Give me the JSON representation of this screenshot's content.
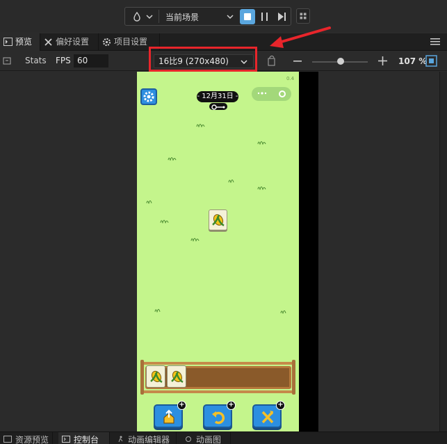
{
  "toolbar": {
    "scene_label": "当前场景",
    "icons": [
      "drop-icon",
      "chevron-down-icon",
      "stop-icon",
      "pause-icon",
      "step-icon",
      "grid-icon"
    ]
  },
  "panel_tabs": [
    {
      "label": "预览",
      "icon": "preview-icon",
      "active": true
    },
    {
      "label": "偏好设置",
      "icon": "tools-icon",
      "active": false
    },
    {
      "label": "项目设置",
      "icon": "gear-icon",
      "active": false
    }
  ],
  "preview_toolbar": {
    "stats_label": "Stats",
    "fps_label": "FPS",
    "fps_value": "60",
    "resolution": "16比9 (270x480)",
    "zoom_value": "107 %"
  },
  "game": {
    "date_label": "- 12月31日 -",
    "tray_tiles": 2,
    "tool_buttons": [
      {
        "name": "move-out-tool",
        "badge": "+"
      },
      {
        "name": "undo-tool",
        "badge": "+"
      },
      {
        "name": "shuffle-tool",
        "badge": "+"
      }
    ]
  },
  "bottom_tabs": [
    {
      "label": "资源预览",
      "active": false
    },
    {
      "label": "控制台",
      "active": true
    },
    {
      "label": "动画编辑器",
      "active": false
    },
    {
      "label": "动画图",
      "active": false
    }
  ],
  "colors": {
    "highlight": "#e8252b",
    "accent": "#5aa6de",
    "game_bg": "#c4f58c",
    "tool_button": "#2c8fe0"
  }
}
